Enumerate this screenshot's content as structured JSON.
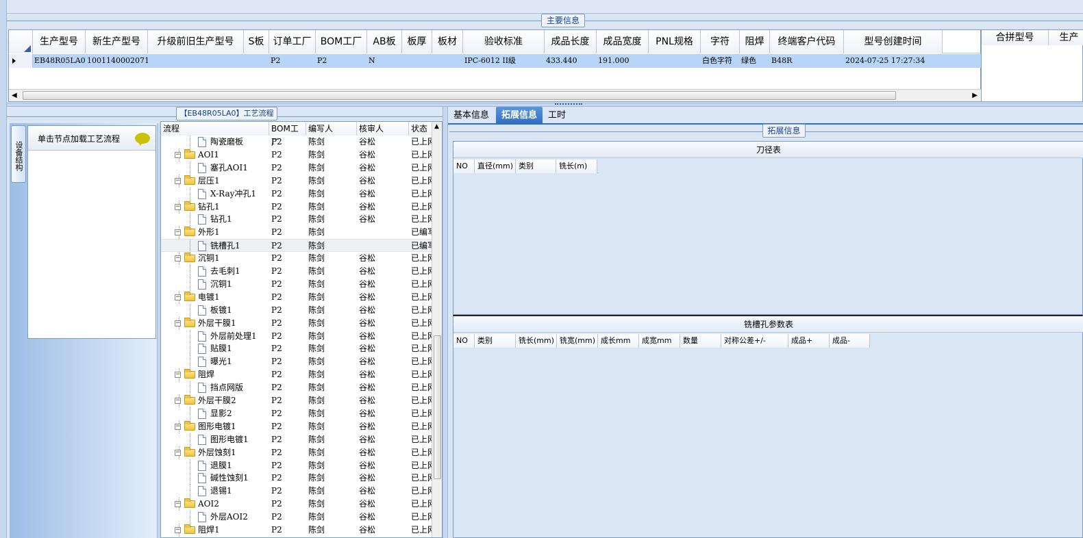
{
  "main_section": {
    "title": "主要信息",
    "columns": [
      "生产型号",
      "新生产型号",
      "升级前旧生产型号",
      "S板",
      "订单工厂",
      "BOM工厂",
      "AB板",
      "板厚",
      "板材",
      "验收标准",
      "成品长度",
      "成品宽度",
      "PNL规格",
      "字符",
      "阻焊",
      "终端客户代码",
      "型号创建时间"
    ],
    "row": [
      "EB48R05LA0",
      "10011400020713",
      "",
      "",
      "P2",
      "P2",
      "N",
      "",
      "",
      "IPC-6012 II级",
      "433.440",
      "191.000",
      "",
      "白色字符",
      "绿色",
      "B48R",
      "2024-07-25 17:27:34"
    ],
    "side_columns": [
      "合拼型号",
      "生产"
    ]
  },
  "left_panel": {
    "vertical_tab": "设备结构",
    "node_hint": "单击节点加载工艺流程"
  },
  "process_panel": {
    "title": "【EB48R05LA0】工艺流程",
    "columns": [
      "流程",
      "BOM工厂",
      "编写人",
      "核审人",
      "状态"
    ],
    "rows": [
      {
        "name": "陶瓷磨板",
        "level": 2,
        "type": "doc",
        "bom": "P2",
        "writer": "陈剑",
        "reviewer": "谷松",
        "status": "已上网"
      },
      {
        "name": "AOI1",
        "level": 1,
        "type": "folder",
        "bom": "P2",
        "writer": "陈剑",
        "reviewer": "谷松",
        "status": "已上网"
      },
      {
        "name": "塞孔AOI1",
        "level": 2,
        "type": "doc",
        "bom": "P2",
        "writer": "陈剑",
        "reviewer": "谷松",
        "status": "已上网"
      },
      {
        "name": "层压1",
        "level": 1,
        "type": "folder",
        "bom": "P2",
        "writer": "陈剑",
        "reviewer": "谷松",
        "status": "已上网"
      },
      {
        "name": "X-Ray冲孔1",
        "level": 2,
        "type": "doc",
        "bom": "P2",
        "writer": "陈剑",
        "reviewer": "谷松",
        "status": "已上网"
      },
      {
        "name": "钻孔1",
        "level": 1,
        "type": "folder",
        "bom": "P2",
        "writer": "陈剑",
        "reviewer": "谷松",
        "status": "已上网"
      },
      {
        "name": "钻孔1",
        "level": 2,
        "type": "doc",
        "bom": "P2",
        "writer": "陈剑",
        "reviewer": "谷松",
        "status": "已上网"
      },
      {
        "name": "外形1",
        "level": 1,
        "type": "folder",
        "bom": "P2",
        "writer": "陈剑",
        "reviewer": "",
        "status": "已编写"
      },
      {
        "name": "铣槽孔1",
        "level": 2,
        "type": "doc",
        "bom": "P2",
        "writer": "陈剑",
        "reviewer": "",
        "status": "已编写",
        "selected": true
      },
      {
        "name": "沉铜1",
        "level": 1,
        "type": "folder",
        "bom": "P2",
        "writer": "陈剑",
        "reviewer": "谷松",
        "status": "已上网"
      },
      {
        "name": "去毛刺1",
        "level": 2,
        "type": "doc",
        "bom": "P2",
        "writer": "陈剑",
        "reviewer": "谷松",
        "status": "已上网"
      },
      {
        "name": "沉铜1",
        "level": 2,
        "type": "doc",
        "bom": "P2",
        "writer": "陈剑",
        "reviewer": "谷松",
        "status": "已上网"
      },
      {
        "name": "电镀1",
        "level": 1,
        "type": "folder",
        "bom": "P2",
        "writer": "陈剑",
        "reviewer": "谷松",
        "status": "已上网"
      },
      {
        "name": "板镀1",
        "level": 2,
        "type": "doc",
        "bom": "P2",
        "writer": "陈剑",
        "reviewer": "谷松",
        "status": "已上网"
      },
      {
        "name": "外层干膜1",
        "level": 1,
        "type": "folder",
        "bom": "P2",
        "writer": "陈剑",
        "reviewer": "谷松",
        "status": "已上网"
      },
      {
        "name": "外层前处理1",
        "level": 2,
        "type": "doc",
        "bom": "P2",
        "writer": "陈剑",
        "reviewer": "谷松",
        "status": "已上网"
      },
      {
        "name": "贴膜1",
        "level": 2,
        "type": "doc",
        "bom": "P2",
        "writer": "陈剑",
        "reviewer": "谷松",
        "status": "已上网"
      },
      {
        "name": "曝光1",
        "level": 2,
        "type": "doc",
        "bom": "P2",
        "writer": "陈剑",
        "reviewer": "谷松",
        "status": "已上网"
      },
      {
        "name": "阻焊",
        "level": 1,
        "type": "folder",
        "bom": "P2",
        "writer": "陈剑",
        "reviewer": "谷松",
        "status": "已上网"
      },
      {
        "name": "挡点网版",
        "level": 2,
        "type": "doc",
        "bom": "P2",
        "writer": "陈剑",
        "reviewer": "谷松",
        "status": "已上网"
      },
      {
        "name": "外层干膜2",
        "level": 1,
        "type": "folder",
        "bom": "P2",
        "writer": "陈剑",
        "reviewer": "谷松",
        "status": "已上网"
      },
      {
        "name": "显影2",
        "level": 2,
        "type": "doc",
        "bom": "P2",
        "writer": "陈剑",
        "reviewer": "谷松",
        "status": "已上网"
      },
      {
        "name": "图形电镀1",
        "level": 1,
        "type": "folder",
        "bom": "P2",
        "writer": "陈剑",
        "reviewer": "谷松",
        "status": "已上网"
      },
      {
        "name": "图形电镀1",
        "level": 2,
        "type": "doc",
        "bom": "P2",
        "writer": "陈剑",
        "reviewer": "谷松",
        "status": "已上网"
      },
      {
        "name": "外层蚀刻1",
        "level": 1,
        "type": "folder",
        "bom": "P2",
        "writer": "陈剑",
        "reviewer": "谷松",
        "status": "已上网"
      },
      {
        "name": "退膜1",
        "level": 2,
        "type": "doc",
        "bom": "P2",
        "writer": "陈剑",
        "reviewer": "谷松",
        "status": "已上网"
      },
      {
        "name": "碱性蚀刻1",
        "level": 2,
        "type": "doc",
        "bom": "P2",
        "writer": "陈剑",
        "reviewer": "谷松",
        "status": "已上网"
      },
      {
        "name": "退锡1",
        "level": 2,
        "type": "doc",
        "bom": "P2",
        "writer": "陈剑",
        "reviewer": "谷松",
        "status": "已上网"
      },
      {
        "name": "AOI2",
        "level": 1,
        "type": "folder",
        "bom": "P2",
        "writer": "陈剑",
        "reviewer": "谷松",
        "status": "已上网"
      },
      {
        "name": "外层AOI2",
        "level": 2,
        "type": "doc",
        "bom": "P2",
        "writer": "陈剑",
        "reviewer": "谷松",
        "status": "已上网"
      },
      {
        "name": "阻焊1",
        "level": 1,
        "type": "folder",
        "bom": "P2",
        "writer": "陈剑",
        "reviewer": "谷松",
        "status": "已上网"
      }
    ]
  },
  "detail_panel": {
    "tabs": [
      "基本信息",
      "拓展信息",
      "工时"
    ],
    "active_tab": "拓展信息",
    "group_title": "拓展信息",
    "tool_table": {
      "title": "刀径表",
      "columns": [
        "NO",
        "直径(mm)",
        "类别",
        "铣长(m)"
      ]
    },
    "slot_table": {
      "title": "铣槽孔参数表",
      "columns": [
        "NO",
        "类别",
        "铣长(mm)",
        "铣宽(mm)",
        "成长mm",
        "成宽mm",
        "数量",
        "对称公差+/-",
        "成品+",
        "成品-"
      ]
    }
  },
  "colors": {
    "accent": "#2f6cc0",
    "header_border": "#7f9db9",
    "panel_bg": "#dbe6f4",
    "row_selected": "#b7d5f7"
  }
}
